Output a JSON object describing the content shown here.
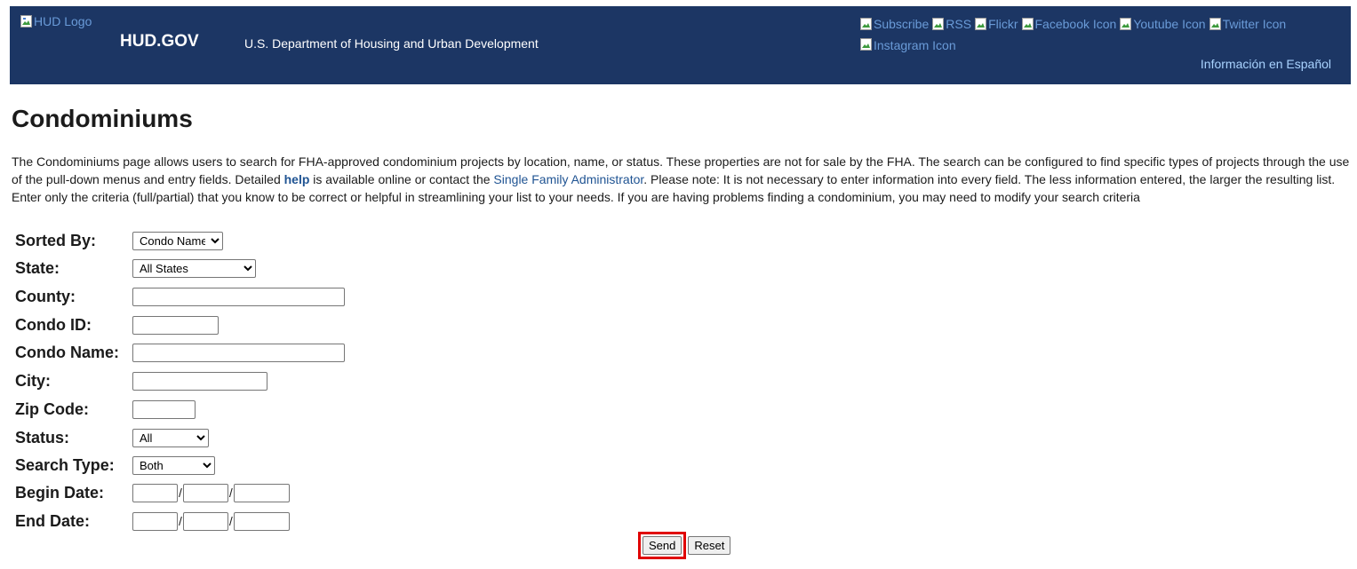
{
  "header": {
    "logo_alt": "HUD Logo",
    "site_name": "HUD.GOV",
    "department": "U.S. Department of Housing and Urban Development",
    "social": [
      "Subscribe",
      "RSS",
      "Flickr",
      "Facebook Icon",
      "Youtube Icon",
      "Twitter Icon",
      "Instagram Icon"
    ],
    "espanol_link": "Información en Español"
  },
  "page": {
    "title": "Condominiums",
    "intro_part1": "The Condominiums page allows users to search for FHA-approved condominium projects by location, name, or status. These properties are not for sale by the FHA. The search can be configured to find specific types of projects through the use of the pull-down menus and entry fields. Detailed ",
    "help_link": "help",
    "intro_part2": " is available online or contact the ",
    "sfa_link": "Single Family Administrator",
    "intro_part3": ". Please note: It is not necessary to enter information into every field. The less information entered, the larger the resulting list. Enter only the criteria (full/partial) that you know to be correct or helpful in streamlining your list to your needs. If you are having problems finding a condominium, you may need to modify your search criteria"
  },
  "form": {
    "sorted_by": {
      "label": "Sorted By:",
      "value": "Condo Name"
    },
    "state": {
      "label": "State:",
      "value": "All States"
    },
    "county": {
      "label": "County:",
      "value": ""
    },
    "condo_id": {
      "label": "Condo ID:",
      "value": ""
    },
    "condo_name": {
      "label": "Condo Name:",
      "value": ""
    },
    "city": {
      "label": "City:",
      "value": ""
    },
    "zip": {
      "label": "Zip Code:",
      "value": ""
    },
    "status": {
      "label": "Status:",
      "value": "All"
    },
    "search_type": {
      "label": "Search Type:",
      "value": "Both"
    },
    "begin_date": {
      "label": "Begin Date:",
      "separator": "/"
    },
    "end_date": {
      "label": "End Date:",
      "separator": "/"
    },
    "send_label": "Send",
    "reset_label": "Reset"
  },
  "colors": {
    "header_bg": "#1c3664",
    "link": "#205493",
    "highlight": "#e00000"
  }
}
